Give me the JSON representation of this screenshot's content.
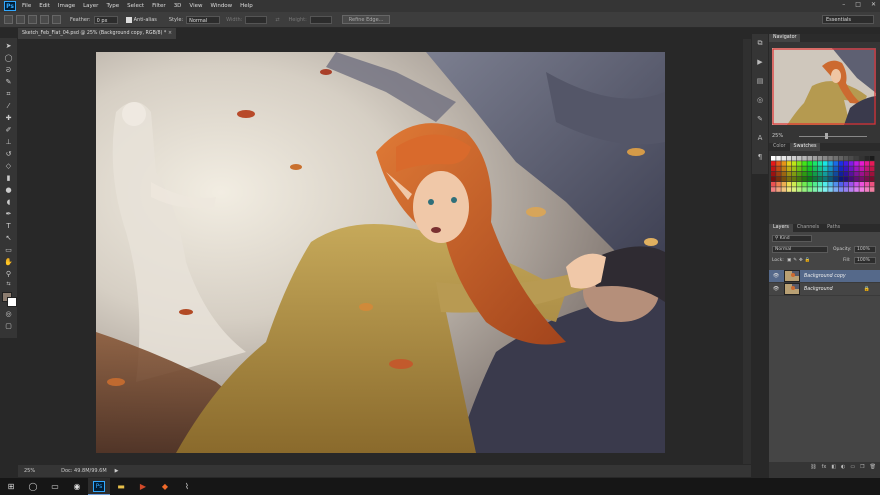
{
  "menu": {
    "logo": "Ps",
    "items": [
      "File",
      "Edit",
      "Image",
      "Layer",
      "Type",
      "Select",
      "Filter",
      "3D",
      "View",
      "Window",
      "Help"
    ],
    "window_controls": [
      "–",
      "□",
      "✕"
    ]
  },
  "options": {
    "feather_label": "Feather:",
    "feather_value": "0 px",
    "antialias_label": "Anti-alias",
    "style_label": "Style:",
    "style_value": "Normal",
    "width_label": "Width:",
    "height_label": "Height:",
    "refine_edge_label": "Refine Edge...",
    "workspace": "Essentials"
  },
  "document": {
    "tab_title": "Sketch_Feb_Flat_04.psd @ 25% (Background copy, RGB/8) *",
    "close": "×"
  },
  "status": {
    "zoom": "25%",
    "doc_size": "Doc: 49.8M/99.6M",
    "arrow": "▶"
  },
  "navigator": {
    "tab": "Navigator",
    "zoom": "25%"
  },
  "swatches": {
    "tabs": [
      "Color",
      "Swatches"
    ],
    "active": "Swatches"
  },
  "layers": {
    "tabs": [
      "Layers",
      "Channels",
      "Paths"
    ],
    "kind": "Kind",
    "blend_mode": "Normal",
    "opacity_label": "Opacity:",
    "opacity_value": "100%",
    "lock_label": "Lock:",
    "fill_label": "Fill:",
    "fill_value": "100%",
    "items": [
      {
        "name": "Background copy",
        "selected": true
      },
      {
        "name": "Background",
        "locked": true
      }
    ],
    "footer_icons": [
      "⛓",
      "fx",
      "◧",
      "◐",
      "▭",
      "❒",
      "🗑"
    ]
  },
  "colors": {
    "foreground": "#8c7d70",
    "background": "#ffffff",
    "selected_layer": "#55698a"
  }
}
